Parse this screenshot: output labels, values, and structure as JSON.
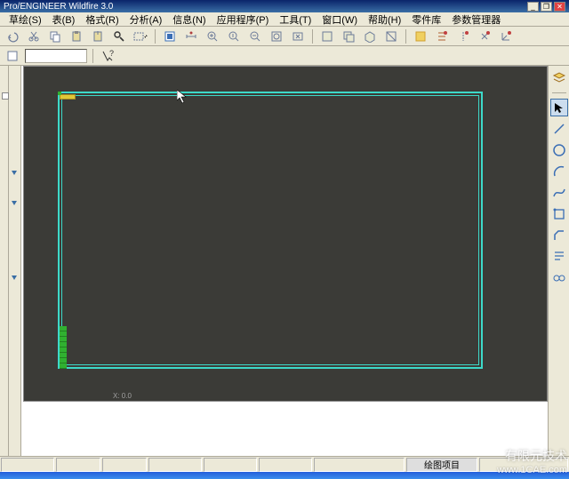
{
  "title": "Pro/ENGINEER Wildfire 3.0",
  "window_buttons": {
    "min": "_",
    "max": "❐",
    "close": "✕"
  },
  "menu": {
    "sketch": "草绘(S)",
    "table": "表(B)",
    "format": "格式(R)",
    "analysis": "分析(A)",
    "info": "信息(N)",
    "applications": "应用程序(P)",
    "tools": "工具(T)",
    "window": "窗口(W)",
    "help": "帮助(H)",
    "parts_lib": "零件库",
    "param_mgr": "参数管理器"
  },
  "toolbar2": {
    "input_value": "",
    "help_icon": "?"
  },
  "right_tools": {
    "layers": "layers-icon",
    "select": "select-arrow-icon",
    "line": "line-icon",
    "circle": "circle-icon",
    "arc": "arc-icon",
    "spline": "spline-icon",
    "box": "box-icon",
    "chamfer": "chamfer-icon",
    "note": "note-icon",
    "chain": "chain-icon"
  },
  "canvas": {
    "coord": "X: 0.0"
  },
  "statusbar": {
    "project": "绘图项目"
  },
  "watermark": {
    "line1": "有限元技术",
    "line2": "www.1CAE.com"
  },
  "colors": {
    "titlebar": "#0a246a",
    "canvas_bg": "#3b3b37",
    "sheet_border": "#3dd9c9",
    "accent_green": "#30b030",
    "accent_yellow": "#e0c838"
  },
  "chart_data": null
}
